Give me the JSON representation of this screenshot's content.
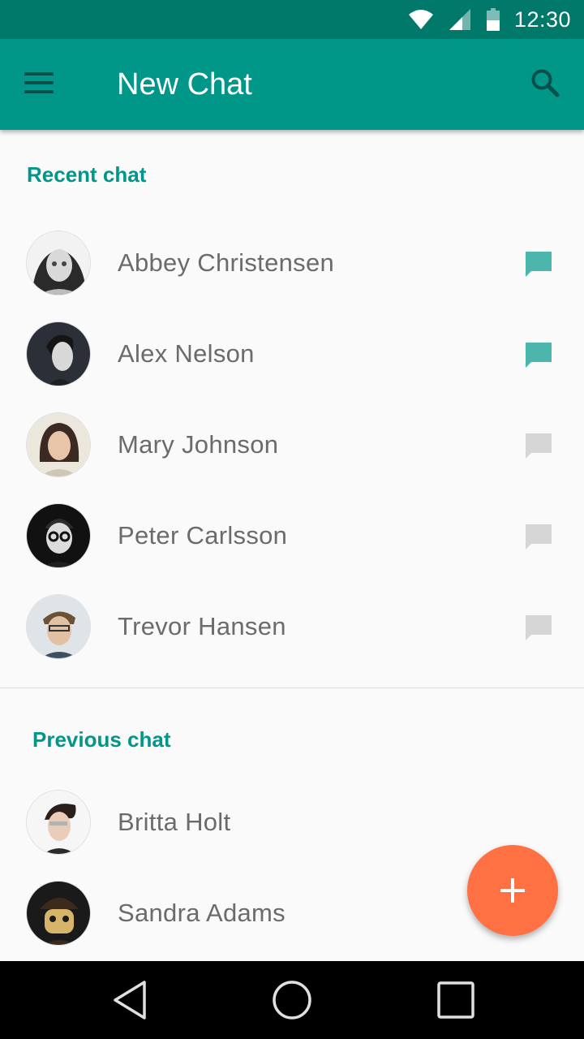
{
  "status_bar": {
    "time": "12:30",
    "icons": [
      "wifi-icon",
      "signal-icon",
      "battery-icon"
    ]
  },
  "app_bar": {
    "title": "New Chat",
    "menu_icon": "menu-icon",
    "search_icon": "search-icon"
  },
  "sections": {
    "recent": {
      "title": "Recent chat",
      "items": [
        {
          "name": "Abbey Christensen",
          "chat_active": true
        },
        {
          "name": "Alex Nelson",
          "chat_active": true
        },
        {
          "name": "Mary Johnson",
          "chat_active": false
        },
        {
          "name": "Peter Carlsson",
          "chat_active": false
        },
        {
          "name": "Trevor Hansen",
          "chat_active": false
        }
      ]
    },
    "previous": {
      "title": "Previous chat",
      "items": [
        {
          "name": "Britta Holt"
        },
        {
          "name": "Sandra Adams"
        }
      ]
    }
  },
  "fab": {
    "label": "+",
    "icon": "add-icon"
  },
  "nav_bar": {
    "icons": [
      "back-icon",
      "home-icon",
      "recents-icon"
    ]
  },
  "colors": {
    "primary": "#009688",
    "primary_dark": "#00796b",
    "accent": "#ff7043",
    "chat_active": "#4db6ac",
    "chat_inactive": "#d6d6d6"
  }
}
